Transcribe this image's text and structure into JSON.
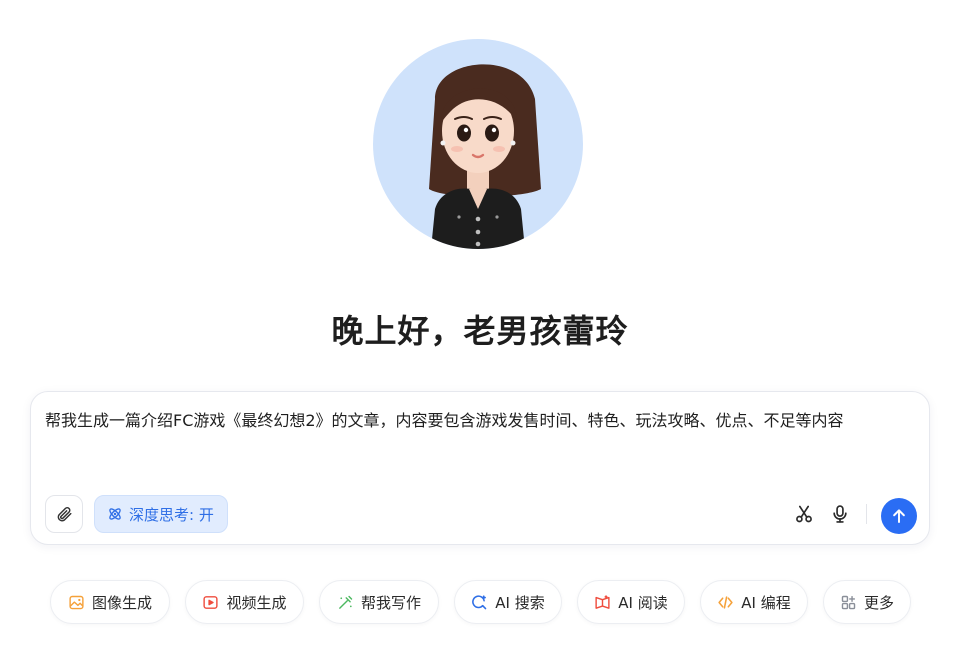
{
  "avatar": {
    "icon": "assistant-avatar",
    "background": "#cfe2fb"
  },
  "greeting": "晚上好，老男孩蕾玲",
  "chat": {
    "prompt": "帮我生成一篇介绍FC游戏《最终幻想2》的文章，内容要包含游戏发售时间、特色、玩法攻略、优点、不足等内容",
    "deep_think_label": "深度思考: 开",
    "accent": "#2a6df4"
  },
  "chips": [
    {
      "label": "图像生成",
      "icon": "image-icon",
      "color": "#f5a13a"
    },
    {
      "label": "视频生成",
      "icon": "video-icon",
      "color": "#ef4d3e"
    },
    {
      "label": "帮我写作",
      "icon": "write-icon",
      "color": "#4cb860"
    },
    {
      "label": "AI 搜索",
      "icon": "search-icon",
      "color": "#2f6fe6"
    },
    {
      "label": "AI 阅读",
      "icon": "read-icon",
      "color": "#ef4d3e"
    },
    {
      "label": "AI 编程",
      "icon": "code-icon",
      "color": "#f5a13a"
    },
    {
      "label": "更多",
      "icon": "more-icon",
      "color": "#8a8f99"
    }
  ]
}
